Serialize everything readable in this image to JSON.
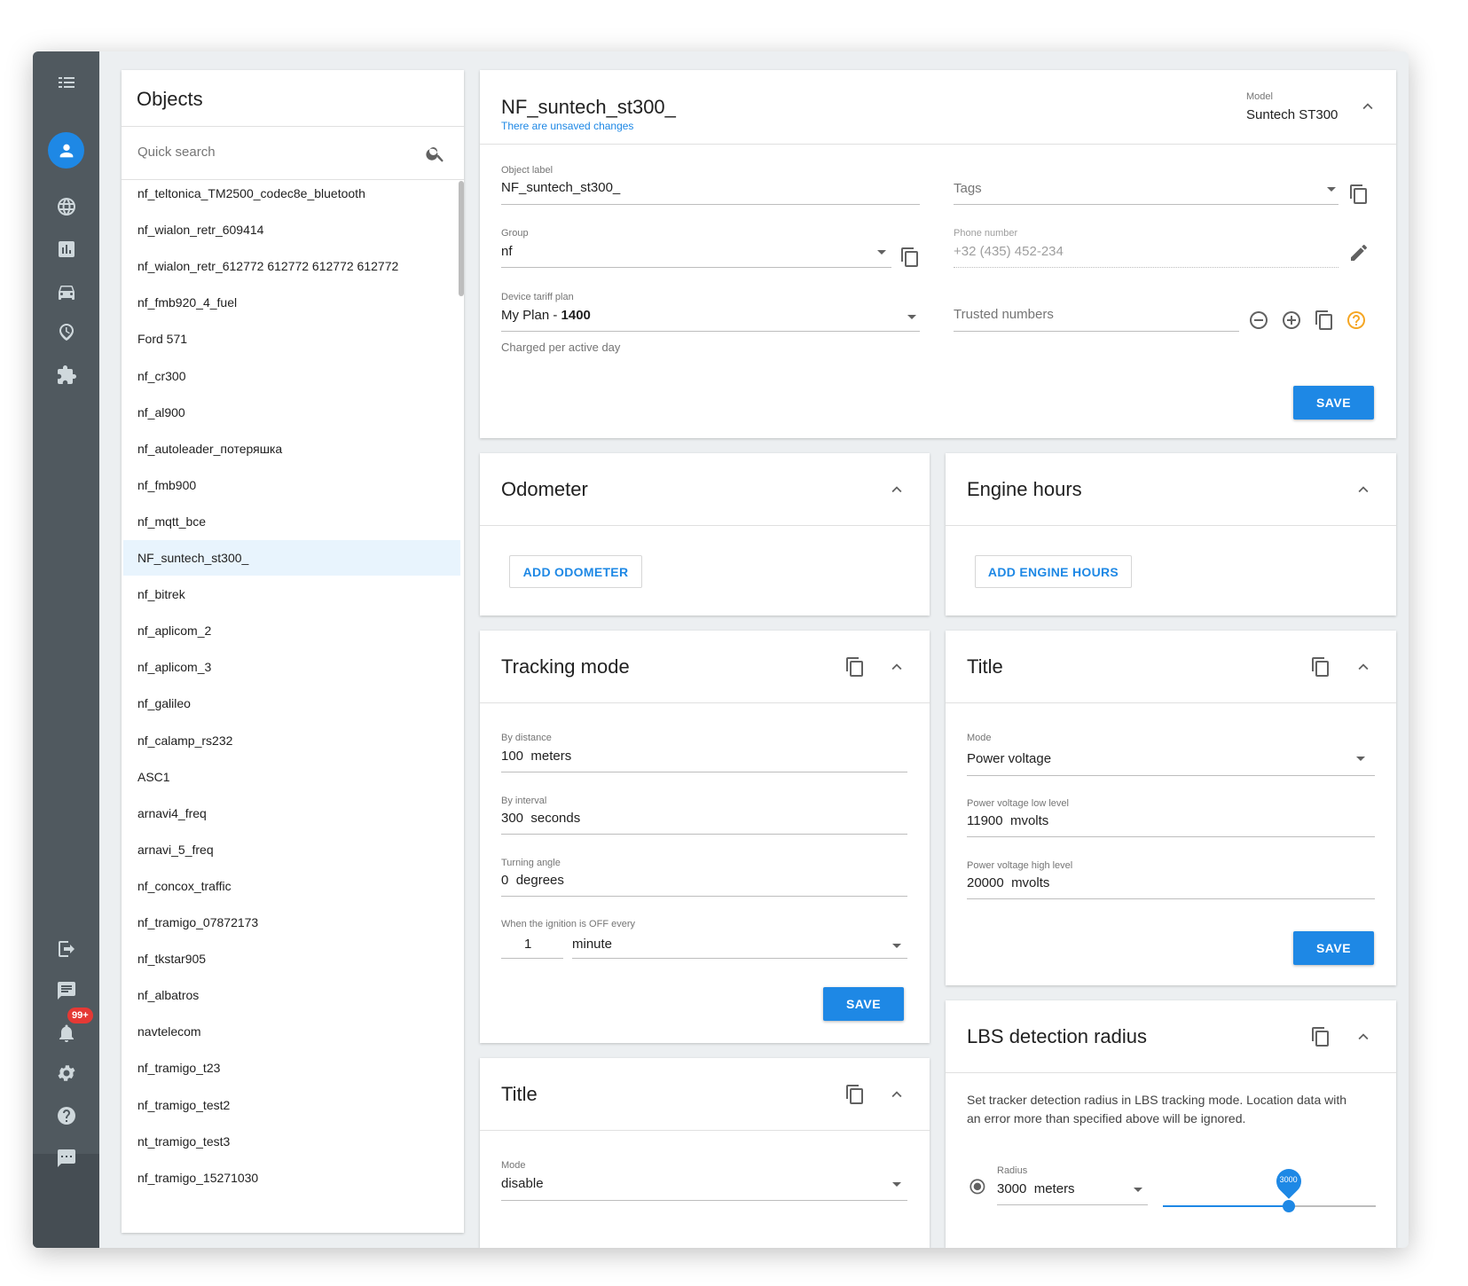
{
  "sidebar": {
    "notifications_badge": "99+"
  },
  "objects": {
    "title": "Objects",
    "search_placeholder": "Quick search",
    "items": [
      "nf_teltonica_TM2500_codec8e_bluetooth",
      "nf_wialon_retr_609414",
      "nf_wialon_retr_612772 612772 612772 612772",
      "nf_fmb920_4_fuel",
      "Ford 571",
      "nf_cr300",
      "nf_al900",
      "nf_autoleader_потеряшка",
      "nf_fmb900",
      "nf_mqtt_bce",
      "NF_suntech_st300_",
      "nf_bitrek",
      "nf_aplicom_2",
      "nf_aplicom_3",
      "nf_galileo",
      "nf_calamp_rs232",
      "ASC1",
      "arnavi4_freq",
      "arnavi_5_freq",
      "nf_concox_traffic",
      "nf_tramigo_07872173",
      "nf_tkstar905",
      "nf_albatros",
      "navtelecom",
      "nf_tramigo_t23",
      "nf_tramigo_test2",
      "nt_tramigo_test3",
      "nf_tramigo_15271030"
    ],
    "selected_index": 10
  },
  "main": {
    "title": "NF_suntech_st300_",
    "unsaved": "There are unsaved changes",
    "model_label": "Model",
    "model_value": "Suntech ST300",
    "object_label_label": "Object label",
    "object_label_value": "NF_suntech_st300_",
    "tags_placeholder": "Tags",
    "group_label": "Group",
    "group_value": "nf",
    "phone_label": "Phone number",
    "phone_value": "+32 (435) 452-234",
    "tariff_label": "Device tariff plan",
    "tariff_value_prefix": "My Plan - ",
    "tariff_value_bold": "1400",
    "tariff_hint": "Charged per active day",
    "trusted_placeholder": "Trusted numbers",
    "save": "SAVE"
  },
  "odometer": {
    "title": "Odometer",
    "add": "ADD ODOMETER"
  },
  "engine_hours": {
    "title": "Engine hours",
    "add": "ADD ENGINE HOURS"
  },
  "tracking": {
    "title": "Tracking mode",
    "distance_label": "By distance",
    "distance_value": "100",
    "distance_unit": "meters",
    "interval_label": "By interval",
    "interval_value": "300",
    "interval_unit": "seconds",
    "angle_label": "Turning angle",
    "angle_value": "0",
    "angle_unit": "degrees",
    "ignition_label": "When the ignition is OFF every",
    "ignition_value": "1",
    "ignition_unit": "minute",
    "save": "SAVE"
  },
  "title_right": {
    "title": "Title",
    "mode_label": "Mode",
    "mode_value": "Power voltage",
    "low_label": "Power voltage low level",
    "low_value": "11900",
    "low_unit": "mvolts",
    "high_label": "Power voltage high level",
    "high_value": "20000",
    "high_unit": "mvolts",
    "save": "SAVE"
  },
  "title_left": {
    "title": "Title",
    "mode_label": "Mode",
    "mode_value": "disable"
  },
  "lbs": {
    "title": "LBS detection radius",
    "description": "Set tracker detection radius in LBS tracking mode. Location data with an error more than specified above will be ignored.",
    "radius_label": "Radius",
    "radius_value": "3000",
    "radius_unit": "meters",
    "slider_value": "3000",
    "slider_fraction": 0.59
  },
  "colors": {
    "accent": "#1e88e5",
    "sidebar": "#50595f",
    "badge": "#e53935",
    "help": "#f5a623",
    "selected_row": "#e8f4fd"
  }
}
